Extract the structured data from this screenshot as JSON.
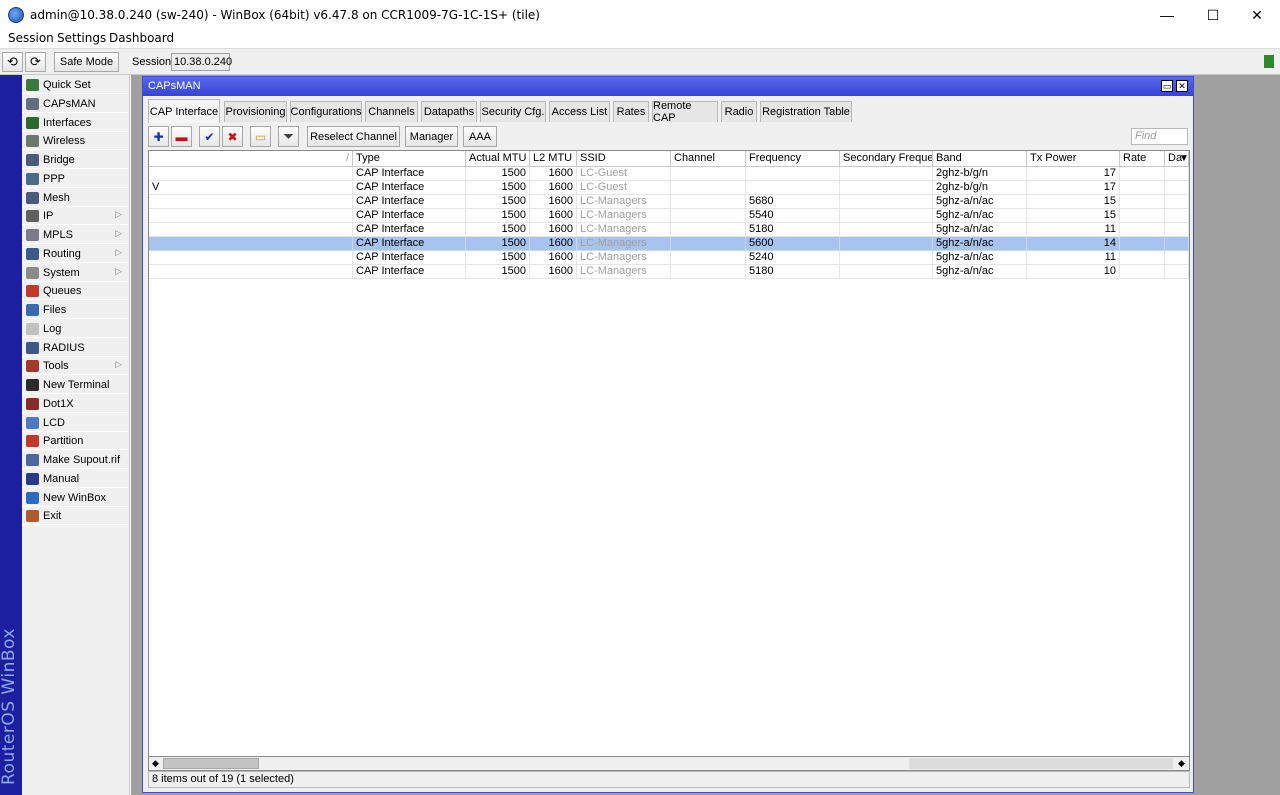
{
  "window": {
    "title": "admin@10.38.0.240 (sw-240) - WinBox (64bit) v6.47.8 on CCR1009-7G-1C-1S+ (tile)",
    "minimize_glyph": "—",
    "maximize_glyph": "☐",
    "close_glyph": "✕"
  },
  "menu": [
    "Session",
    "Settings",
    "Dashboard"
  ],
  "toolbar": {
    "undo_glyph": "⟲",
    "redo_glyph": "⟳",
    "safe_mode": "Safe Mode",
    "session_label": "Session:",
    "session_value": "10.38.0.240"
  },
  "brand_vertical": "RouterOS WinBox",
  "sidebar": {
    "items": [
      {
        "label": "Quick Set",
        "icon": "quick-set-icon",
        "color": "#3a7a3a",
        "arrow": false
      },
      {
        "label": "CAPsMAN",
        "icon": "capsman-icon",
        "color": "#607080",
        "arrow": false
      },
      {
        "label": "Interfaces",
        "icon": "interfaces-icon",
        "color": "#2a6a2a",
        "arrow": false
      },
      {
        "label": "Wireless",
        "icon": "wireless-icon",
        "color": "#6a7a6a",
        "arrow": false
      },
      {
        "label": "Bridge",
        "icon": "bridge-icon",
        "color": "#4a5a7a",
        "arrow": false
      },
      {
        "label": "PPP",
        "icon": "ppp-icon",
        "color": "#4a6a8a",
        "arrow": false
      },
      {
        "label": "Mesh",
        "icon": "mesh-icon",
        "color": "#4a5a7a",
        "arrow": false
      },
      {
        "label": "IP",
        "icon": "ip-icon",
        "color": "#606060",
        "arrow": true
      },
      {
        "label": "MPLS",
        "icon": "mpls-icon",
        "color": "#7a7a8a",
        "arrow": true
      },
      {
        "label": "Routing",
        "icon": "routing-icon",
        "color": "#3a5a8a",
        "arrow": true
      },
      {
        "label": "System",
        "icon": "system-icon",
        "color": "#8a8a8a",
        "arrow": true
      },
      {
        "label": "Queues",
        "icon": "queues-icon",
        "color": "#c03a2a",
        "arrow": false
      },
      {
        "label": "Files",
        "icon": "files-icon",
        "color": "#3a6ab0",
        "arrow": false
      },
      {
        "label": "Log",
        "icon": "log-icon",
        "color": "#c0c0c0",
        "arrow": false
      },
      {
        "label": "RADIUS",
        "icon": "radius-icon",
        "color": "#3a5a8a",
        "arrow": false
      },
      {
        "label": "Tools",
        "icon": "tools-icon",
        "color": "#a03a2a",
        "arrow": true
      },
      {
        "label": "New Terminal",
        "icon": "terminal-icon",
        "color": "#2a2a2a",
        "arrow": false
      },
      {
        "label": "Dot1X",
        "icon": "dot1x-icon",
        "color": "#8a2a2a",
        "arrow": false
      },
      {
        "label": "LCD",
        "icon": "lcd-icon",
        "color": "#4a7ac0",
        "arrow": false
      },
      {
        "label": "Partition",
        "icon": "partition-icon",
        "color": "#c03a2a",
        "arrow": false
      },
      {
        "label": "Make Supout.rif",
        "icon": "supout-icon",
        "color": "#4a6a9a",
        "arrow": false
      },
      {
        "label": "Manual",
        "icon": "manual-icon",
        "color": "#2a3a8a",
        "arrow": false
      },
      {
        "label": "New WinBox",
        "icon": "winbox-icon",
        "color": "#2a6ac0",
        "arrow": false
      },
      {
        "label": "Exit",
        "icon": "exit-icon",
        "color": "#b05a2a",
        "arrow": false
      }
    ]
  },
  "capsman": {
    "title": "CAPsMAN",
    "restore_glyph": "▭",
    "close_glyph": "✕",
    "tabs": [
      "CAP Interface",
      "Provisioning",
      "Configurations",
      "Channels",
      "Datapaths",
      "Security Cfg.",
      "Access List",
      "Rates",
      "Remote CAP",
      "Radio",
      "Registration Table"
    ],
    "active_tab": "CAP Interface",
    "icon_buttons": [
      {
        "name": "add-icon",
        "glyph": "✚",
        "color": "#1030c0"
      },
      {
        "name": "remove-icon",
        "glyph": "▬",
        "color": "#c01010"
      },
      {
        "name": "enable-icon",
        "glyph": "✔",
        "color": "#1030c0"
      },
      {
        "name": "disable-icon",
        "glyph": "✖",
        "color": "#d01010"
      },
      {
        "name": "comment-icon",
        "glyph": "▭",
        "color": "#c8a800"
      },
      {
        "name": "filter-icon",
        "glyph": "⏷",
        "color": "#404040"
      }
    ],
    "buttons": [
      "Reselect Channel",
      "Manager",
      "AAA"
    ],
    "find_placeholder": "Find",
    "columns": [
      "/",
      "Type",
      "Actual MTU",
      "L2 MTU",
      "SSID",
      "Channel",
      "Frequency",
      "Secondary Freque...",
      "Band",
      "Tx Power",
      "Rate",
      "Da"
    ],
    "rows": [
      {
        "flag": "",
        "type": "CAP Interface",
        "actual_mtu": "1500",
        "l2_mtu": "1600",
        "ssid": "LC-Guest",
        "channel": "",
        "frequency": "",
        "secondary": "",
        "band": "2ghz-b/g/n",
        "tx_power": "17",
        "rate": "",
        "da": ""
      },
      {
        "flag": "V",
        "type": "CAP Interface",
        "actual_mtu": "1500",
        "l2_mtu": "1600",
        "ssid": "LC-Guest",
        "channel": "",
        "frequency": "",
        "secondary": "",
        "band": "2ghz-b/g/n",
        "tx_power": "17",
        "rate": "",
        "da": ""
      },
      {
        "flag": "",
        "type": "CAP Interface",
        "actual_mtu": "1500",
        "l2_mtu": "1600",
        "ssid": "LC-Managers",
        "channel": "",
        "frequency": "5680",
        "secondary": "",
        "band": "5ghz-a/n/ac",
        "tx_power": "15",
        "rate": "",
        "da": ""
      },
      {
        "flag": "",
        "type": "CAP Interface",
        "actual_mtu": "1500",
        "l2_mtu": "1600",
        "ssid": "LC-Managers",
        "channel": "",
        "frequency": "5540",
        "secondary": "",
        "band": "5ghz-a/n/ac",
        "tx_power": "15",
        "rate": "",
        "da": ""
      },
      {
        "flag": "",
        "type": "CAP Interface",
        "actual_mtu": "1500",
        "l2_mtu": "1600",
        "ssid": "LC-Managers",
        "channel": "",
        "frequency": "5180",
        "secondary": "",
        "band": "5ghz-a/n/ac",
        "tx_power": "11",
        "rate": "",
        "da": ""
      },
      {
        "flag": "",
        "type": "CAP Interface",
        "actual_mtu": "1500",
        "l2_mtu": "1600",
        "ssid": "LC-Managers",
        "channel": "",
        "frequency": "5600",
        "secondary": "",
        "band": "5ghz-a/n/ac",
        "tx_power": "14",
        "rate": "",
        "da": "",
        "selected": true
      },
      {
        "flag": "",
        "type": "CAP Interface",
        "actual_mtu": "1500",
        "l2_mtu": "1600",
        "ssid": "LC-Managers",
        "channel": "",
        "frequency": "5240",
        "secondary": "",
        "band": "5ghz-a/n/ac",
        "tx_power": "11",
        "rate": "",
        "da": ""
      },
      {
        "flag": "",
        "type": "CAP Interface",
        "actual_mtu": "1500",
        "l2_mtu": "1600",
        "ssid": "LC-Managers",
        "channel": "",
        "frequency": "5180",
        "secondary": "",
        "band": "5ghz-a/n/ac",
        "tx_power": "10",
        "rate": "",
        "da": ""
      }
    ],
    "status": "8 items out of 19 (1 selected)"
  }
}
